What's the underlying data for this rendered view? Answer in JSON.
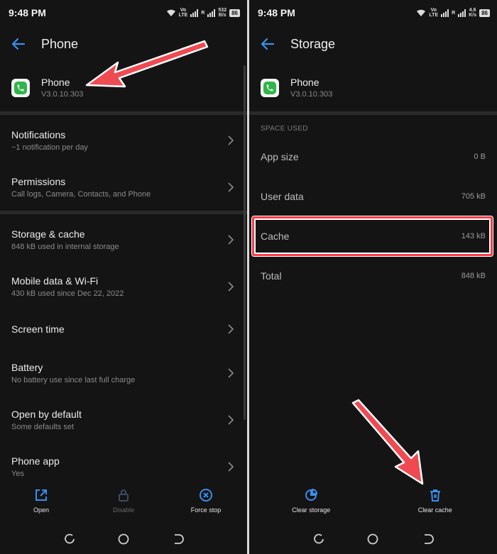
{
  "left": {
    "status": {
      "time": "9:48 PM",
      "net1": "Vo\nLTE",
      "net2": "R",
      "speed": "532\nB/s",
      "battery": "86"
    },
    "title": "Phone",
    "app": {
      "name": "Phone",
      "version": "V3.0.10.303"
    },
    "items": [
      {
        "label": "Notifications",
        "sub": "~1 notification per day"
      },
      {
        "label": "Permissions",
        "sub": "Call logs, Camera, Contacts, and Phone"
      },
      {
        "label": "Storage & cache",
        "sub": "848 kB used in internal storage"
      },
      {
        "label": "Mobile data & Wi-Fi",
        "sub": "430 kB used since Dec 22, 2022"
      },
      {
        "label": "Screen time",
        "sub": ""
      },
      {
        "label": "Battery",
        "sub": "No battery use since last full charge"
      },
      {
        "label": "Open by default",
        "sub": "Some defaults set"
      },
      {
        "label": "Phone app",
        "sub": "Yes"
      }
    ],
    "actions": {
      "open": "Open",
      "disable": "Disable",
      "force_stop": "Force stop"
    }
  },
  "right": {
    "status": {
      "time": "9:48 PM",
      "net1": "Vo\nLTE",
      "net2": "R",
      "speed": "4.6\nK/s",
      "battery": "86"
    },
    "title": "Storage",
    "app": {
      "name": "Phone",
      "version": "V3.0.10.303"
    },
    "section": "SPACE USED",
    "rows": [
      {
        "label": "App size",
        "value": "0 B"
      },
      {
        "label": "User data",
        "value": "705 kB"
      },
      {
        "label": "Cache",
        "value": "143 kB"
      },
      {
        "label": "Total",
        "value": "848 kB"
      }
    ],
    "actions": {
      "clear_storage": "Clear storage",
      "clear_cache": "Clear cache"
    }
  },
  "colors": {
    "accent": "#3a8ef0",
    "background": "#141414",
    "annotation": "#ff3b47",
    "app_green": "#2fb64a"
  },
  "icons": [
    "back-arrow-icon",
    "chevron-right-icon",
    "open-external-icon",
    "lock-icon",
    "close-circle-icon",
    "pie-chart-icon",
    "trash-icon",
    "wifi-icon",
    "recent-apps-icon",
    "home-icon",
    "back-icon"
  ]
}
